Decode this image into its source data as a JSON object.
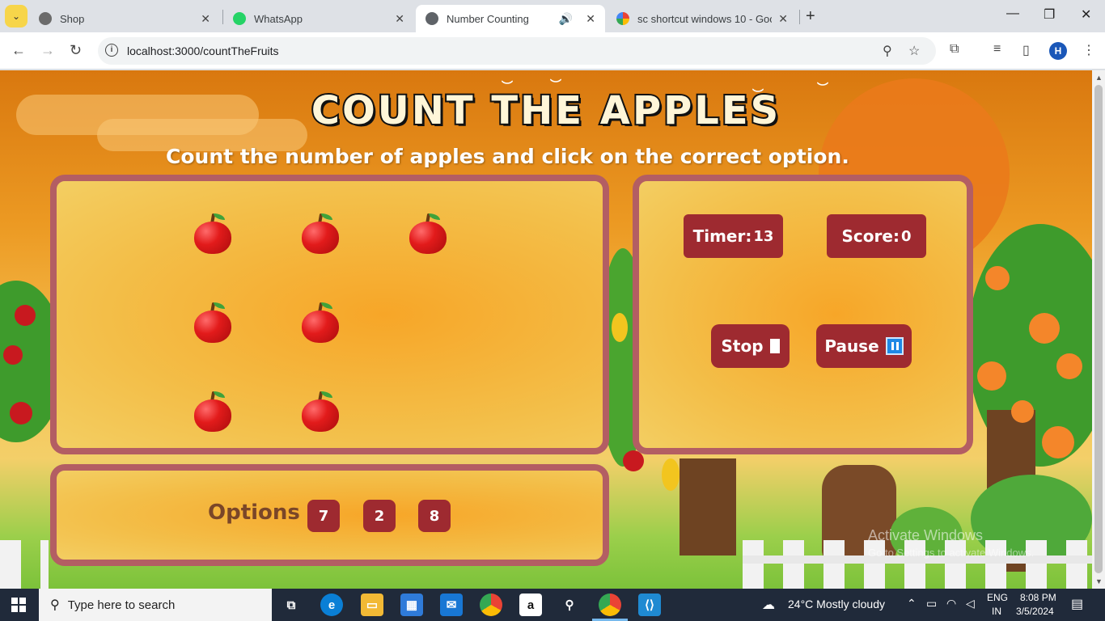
{
  "browser": {
    "tabs": [
      {
        "title": "Shop",
        "active": false
      },
      {
        "title": "WhatsApp",
        "active": false
      },
      {
        "title": "Number Counting",
        "active": true
      },
      {
        "title": "sc shortcut windows 10 - Goog",
        "active": false
      }
    ],
    "url": "localhost:3000/countTheFruits",
    "profile_initial": "H"
  },
  "game": {
    "title": "COUNT THE APPLES",
    "instruction": "Count the number of apples and click on the correct option.",
    "apple_count": 7,
    "timer_label": "Timer:",
    "timer_value": "13",
    "score_label": "Score:",
    "score_value": "0",
    "stop_label": "Stop",
    "pause_label": "Pause",
    "options_label": "Options",
    "options": [
      "7",
      "2",
      "8"
    ]
  },
  "watermark": {
    "line1": "Activate Windows",
    "line2": "Go to Settings to activate Windows."
  },
  "taskbar": {
    "search_placeholder": "Type here to search",
    "weather": "24°C  Mostly cloudy",
    "lang1": "ENG",
    "lang2": "IN",
    "time": "8:08 PM",
    "date": "3/5/2024"
  },
  "colors": {
    "accent": "#9e2a30",
    "panel_border": "#b35e63",
    "title_fill": "#fff6d8"
  }
}
